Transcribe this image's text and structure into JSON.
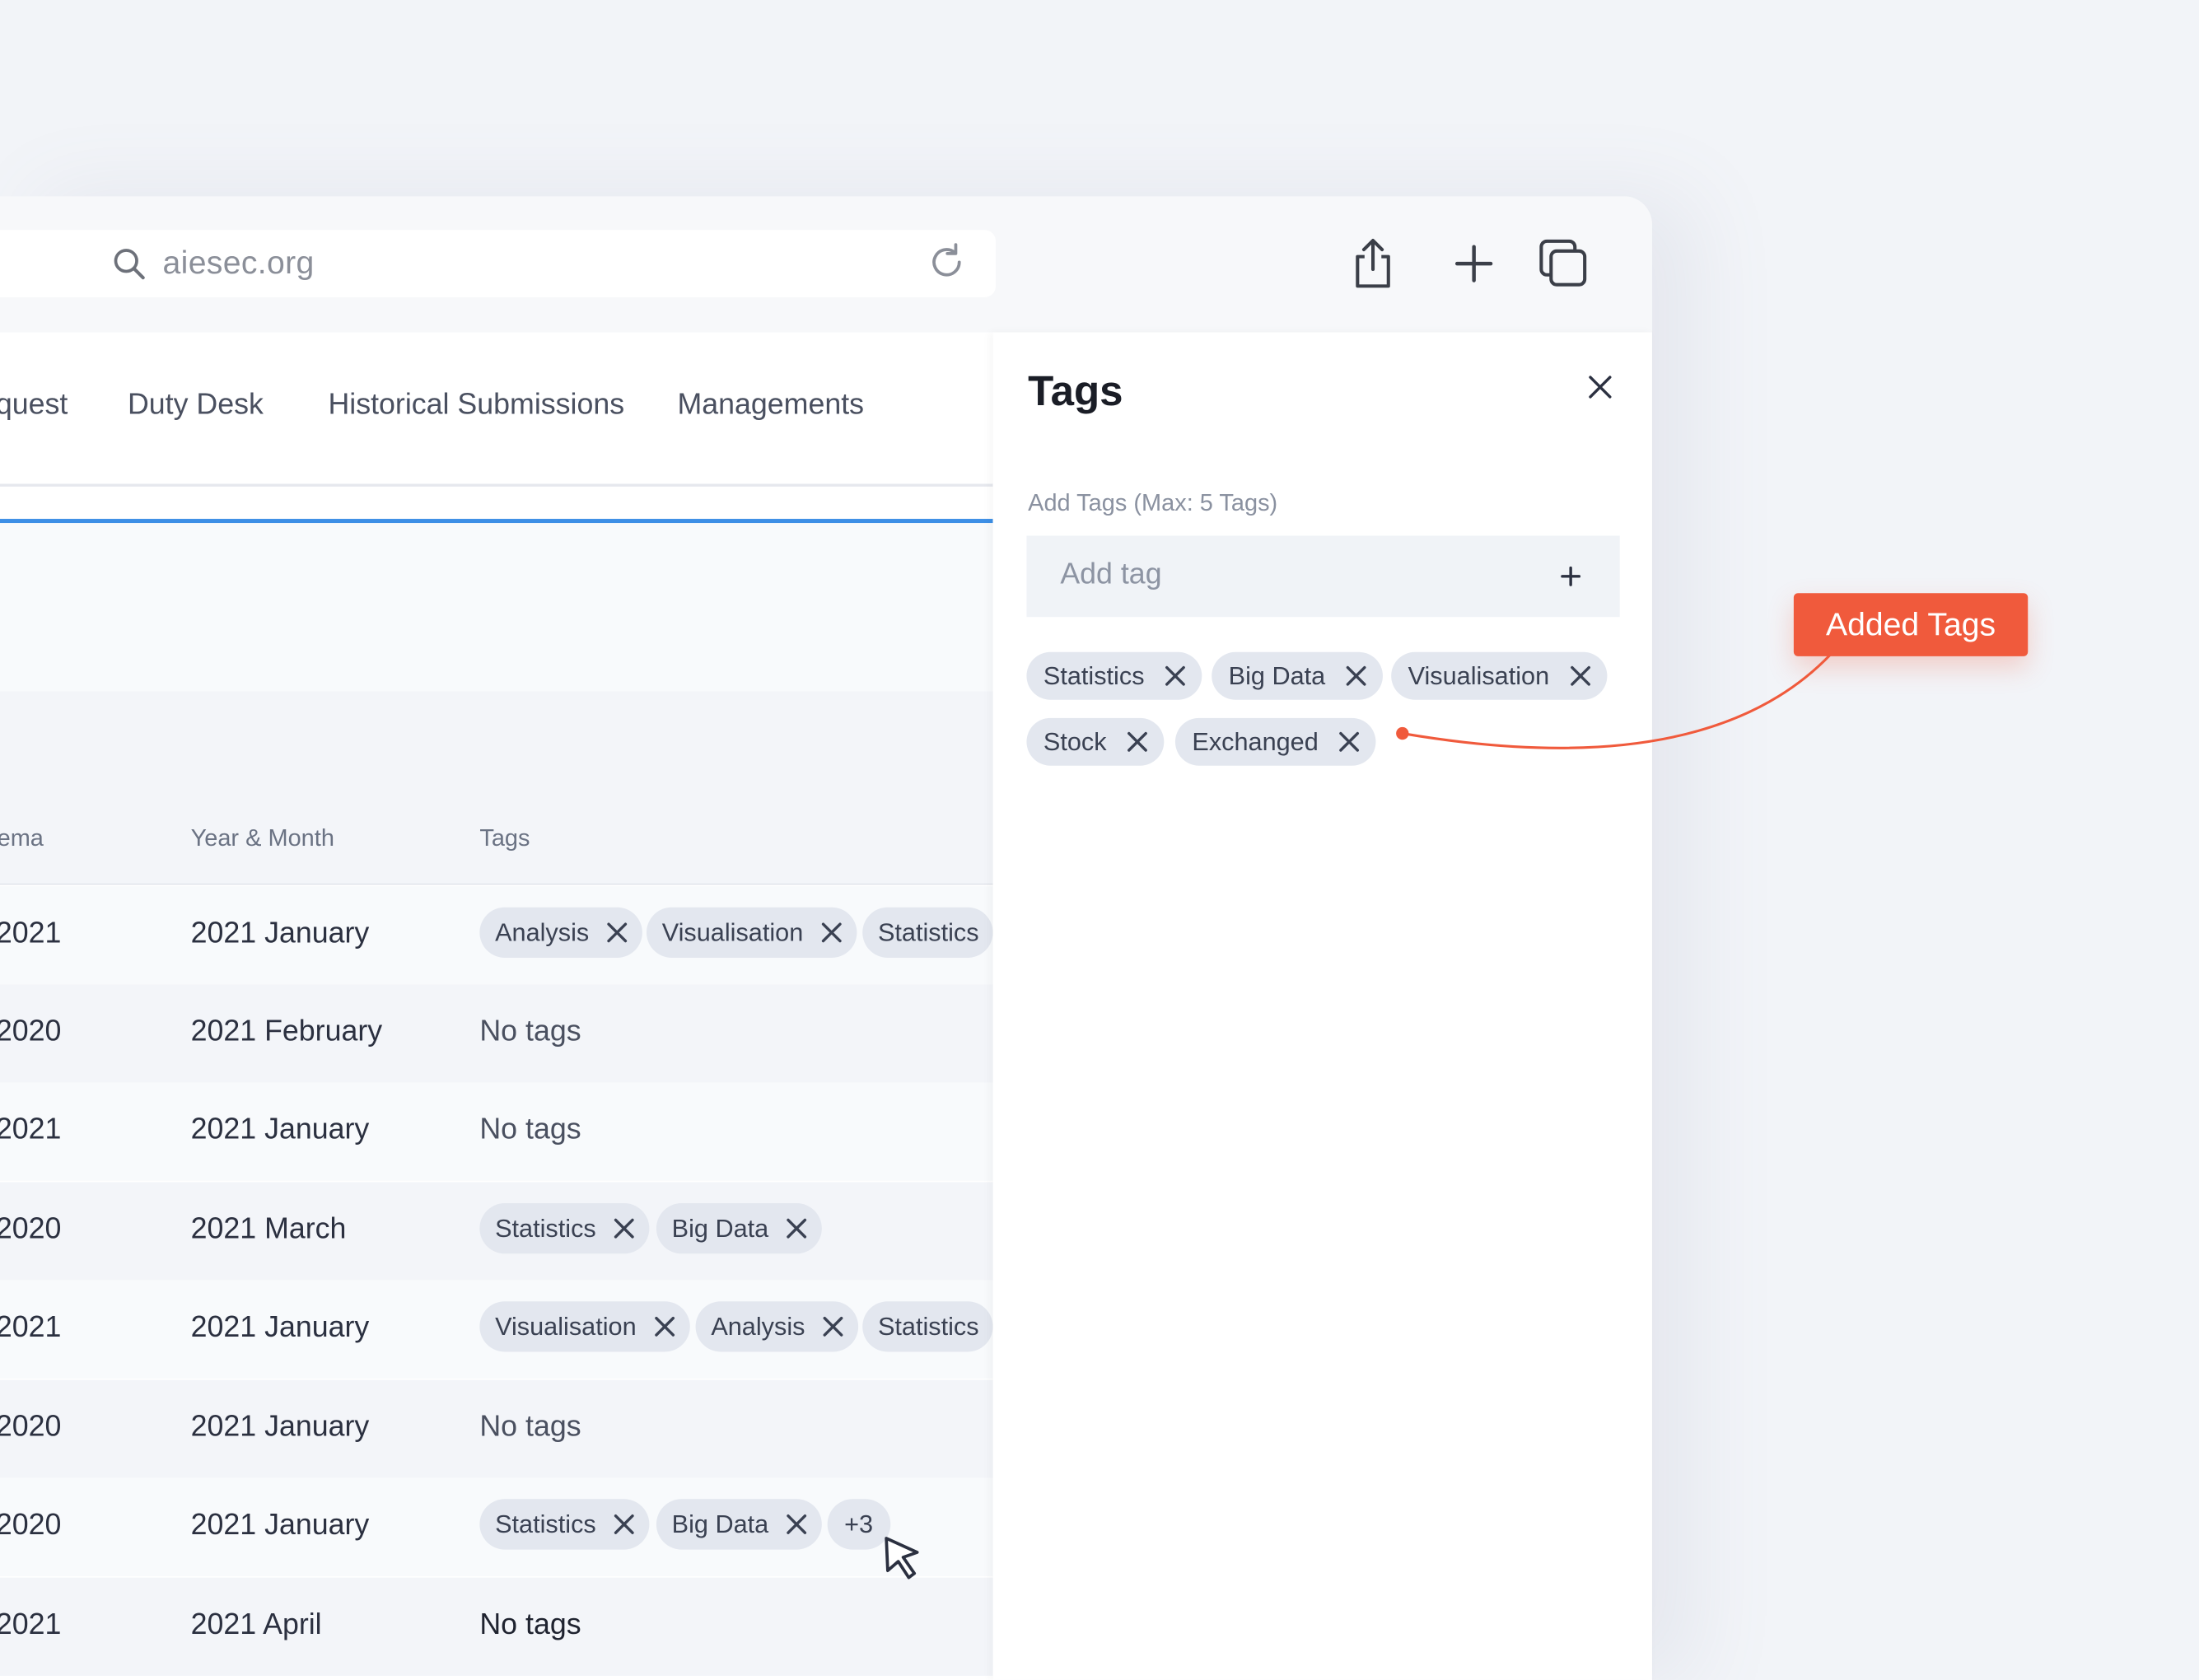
{
  "browser": {
    "url": "aiesec.org",
    "icons": {
      "search": "search-icon",
      "reload": "reload-icon",
      "share": "share-icon",
      "new_tab": "plus-icon",
      "tabs": "tabs-icon"
    }
  },
  "nav": {
    "tabs": [
      {
        "label": "quest"
      },
      {
        "label": "Duty Desk"
      },
      {
        "label": "Historical Submissions"
      },
      {
        "label": "Managements"
      }
    ]
  },
  "table": {
    "headers": {
      "col1": "ema",
      "col2": "Year & Month",
      "col3": "Tags"
    },
    "rows": [
      {
        "year": "2021",
        "month": "2021 January",
        "tags": [
          "Analysis",
          "Visualisation",
          "Statistics"
        ]
      },
      {
        "year": "2020",
        "month": "2021 February",
        "empty": "No tags"
      },
      {
        "year": "2021",
        "month": "2021 January",
        "empty": "No tags"
      },
      {
        "year": "2020",
        "month": "2021 March",
        "tags": [
          "Statistics",
          "Big Data"
        ]
      },
      {
        "year": "2021",
        "month": "2021 January",
        "tags": [
          "Visualisation",
          "Analysis",
          "Statistics"
        ]
      },
      {
        "year": "2020",
        "month": "2021 January",
        "empty": "No tags"
      },
      {
        "year": "2020",
        "month": "2021 January",
        "tags": [
          "Statistics",
          "Big Data"
        ],
        "more": "+3"
      },
      {
        "year": "2021",
        "month": "2021 April",
        "empty": "No tags"
      }
    ]
  },
  "panel": {
    "title": "Tags",
    "label": "Add Tags (Max: 5 Tags)",
    "input_placeholder": "Add tag",
    "tags": [
      "Statistics",
      "Big Data",
      "Visualisation",
      "Stock",
      "Exchanged"
    ]
  },
  "callout": {
    "label": "Added Tags",
    "color": "#f05a3c"
  },
  "colors": {
    "accent": "#3d8fe6",
    "chip_bg": "#e3e7ef"
  }
}
